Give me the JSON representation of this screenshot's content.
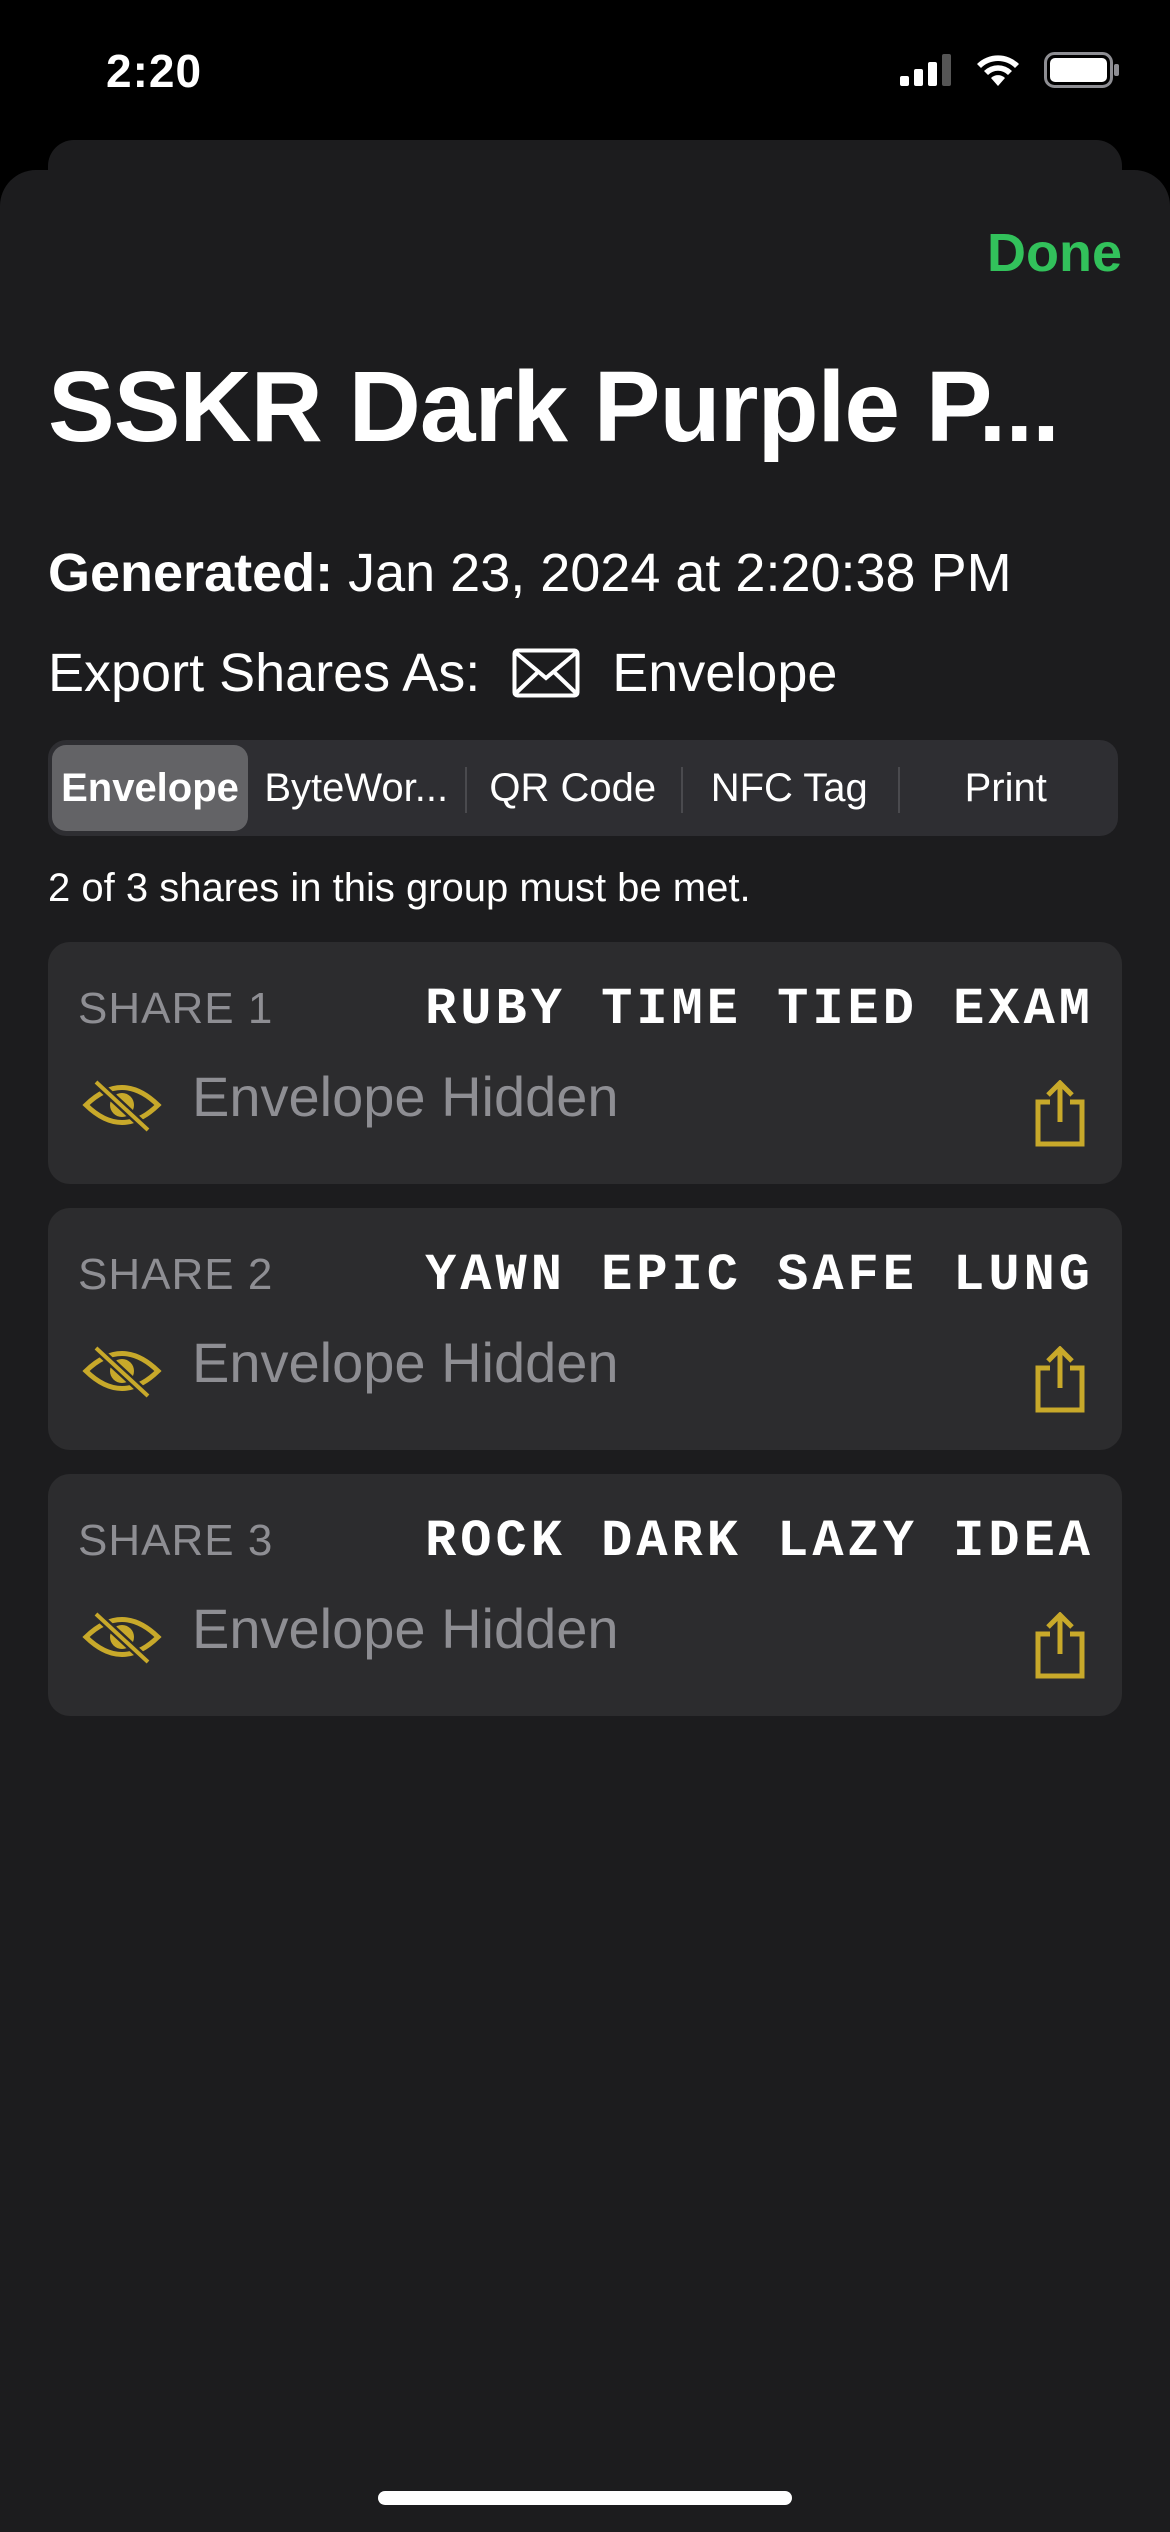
{
  "status_bar": {
    "time": "2:20"
  },
  "header": {
    "done_label": "Done"
  },
  "title": "SSKR Dark Purple P...",
  "generated": {
    "label": "Generated:",
    "value": "Jan 23, 2024 at 2:20:38 PM"
  },
  "export": {
    "label": "Export Shares As:",
    "format": "Envelope",
    "icon": "envelope-icon"
  },
  "segments": [
    "Envelope",
    "ByteWor...",
    "QR Code",
    "NFC Tag",
    "Print"
  ],
  "selected_segment": "Envelope",
  "requirement": "2 of 3 shares in this group must be met.",
  "shares": [
    {
      "label": "SHARE 1",
      "words": "RUBY TIME TIED EXAM",
      "status": "Envelope Hidden"
    },
    {
      "label": "SHARE 2",
      "words": "YAWN EPIC SAFE LUNG",
      "status": "Envelope Hidden"
    },
    {
      "label": "SHARE 3",
      "words": "ROCK DARK LAZY IDEA",
      "status": "Envelope Hidden"
    }
  ],
  "colors": {
    "accent_green": "#32c15b",
    "icon_gold": "#c8a92a",
    "background": "#1c1c1e",
    "card": "#2c2c2e"
  }
}
